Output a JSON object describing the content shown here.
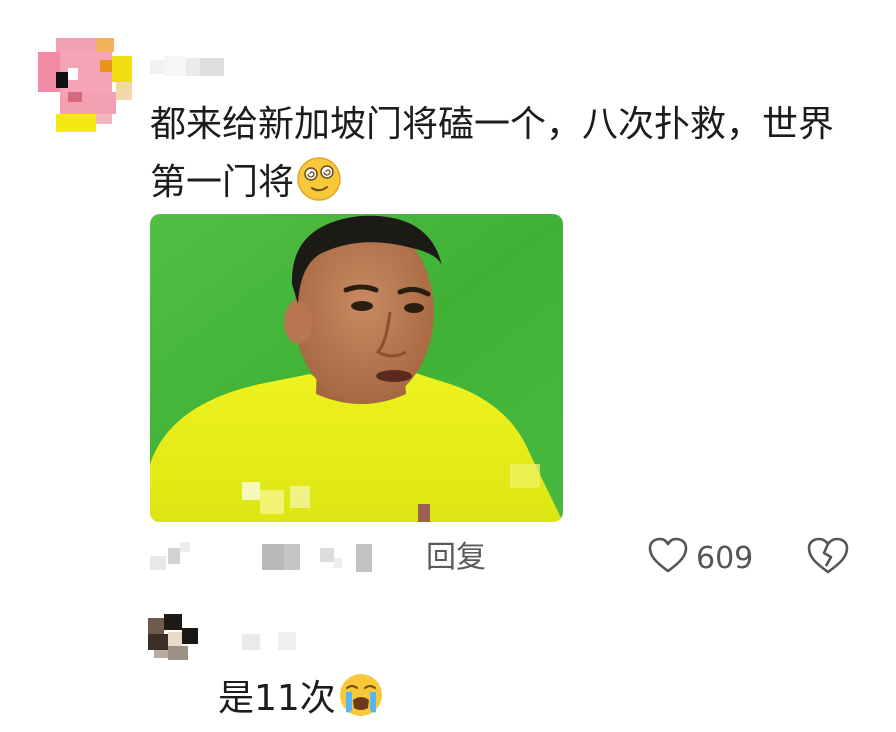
{
  "comment": {
    "text_before_emoji": "都来给新加坡门将磕一个，八次扑救，世界第一门将",
    "emoji": "smiling-face-with-spiral-eyes"
  },
  "actions": {
    "reply_label": "回复",
    "like_count": "609"
  },
  "reply": {
    "text_before_emoji": "是11次",
    "emoji": "loudly-crying-face"
  },
  "colors": {
    "jersey_yellow": "#e7ef1a",
    "pitch_green": "#43b83a",
    "meta_gray": "#555555"
  }
}
